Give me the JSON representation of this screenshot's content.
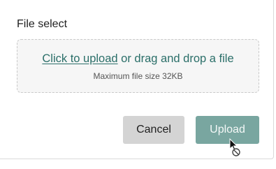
{
  "file_select": {
    "label": "File select",
    "link_text": "Click to upload",
    "drop_text": " or drag and drop a file",
    "hint": "Maximum file size 32KB"
  },
  "actions": {
    "cancel_label": "Cancel",
    "upload_label": "Upload",
    "upload_state": "disabled"
  },
  "colors": {
    "accent": "#2b6f69",
    "upload_disabled_bg": "#79a6a0",
    "cancel_bg": "#d4d4d4"
  },
  "cursor": {
    "icon": "not-allowed-cursor-icon"
  }
}
